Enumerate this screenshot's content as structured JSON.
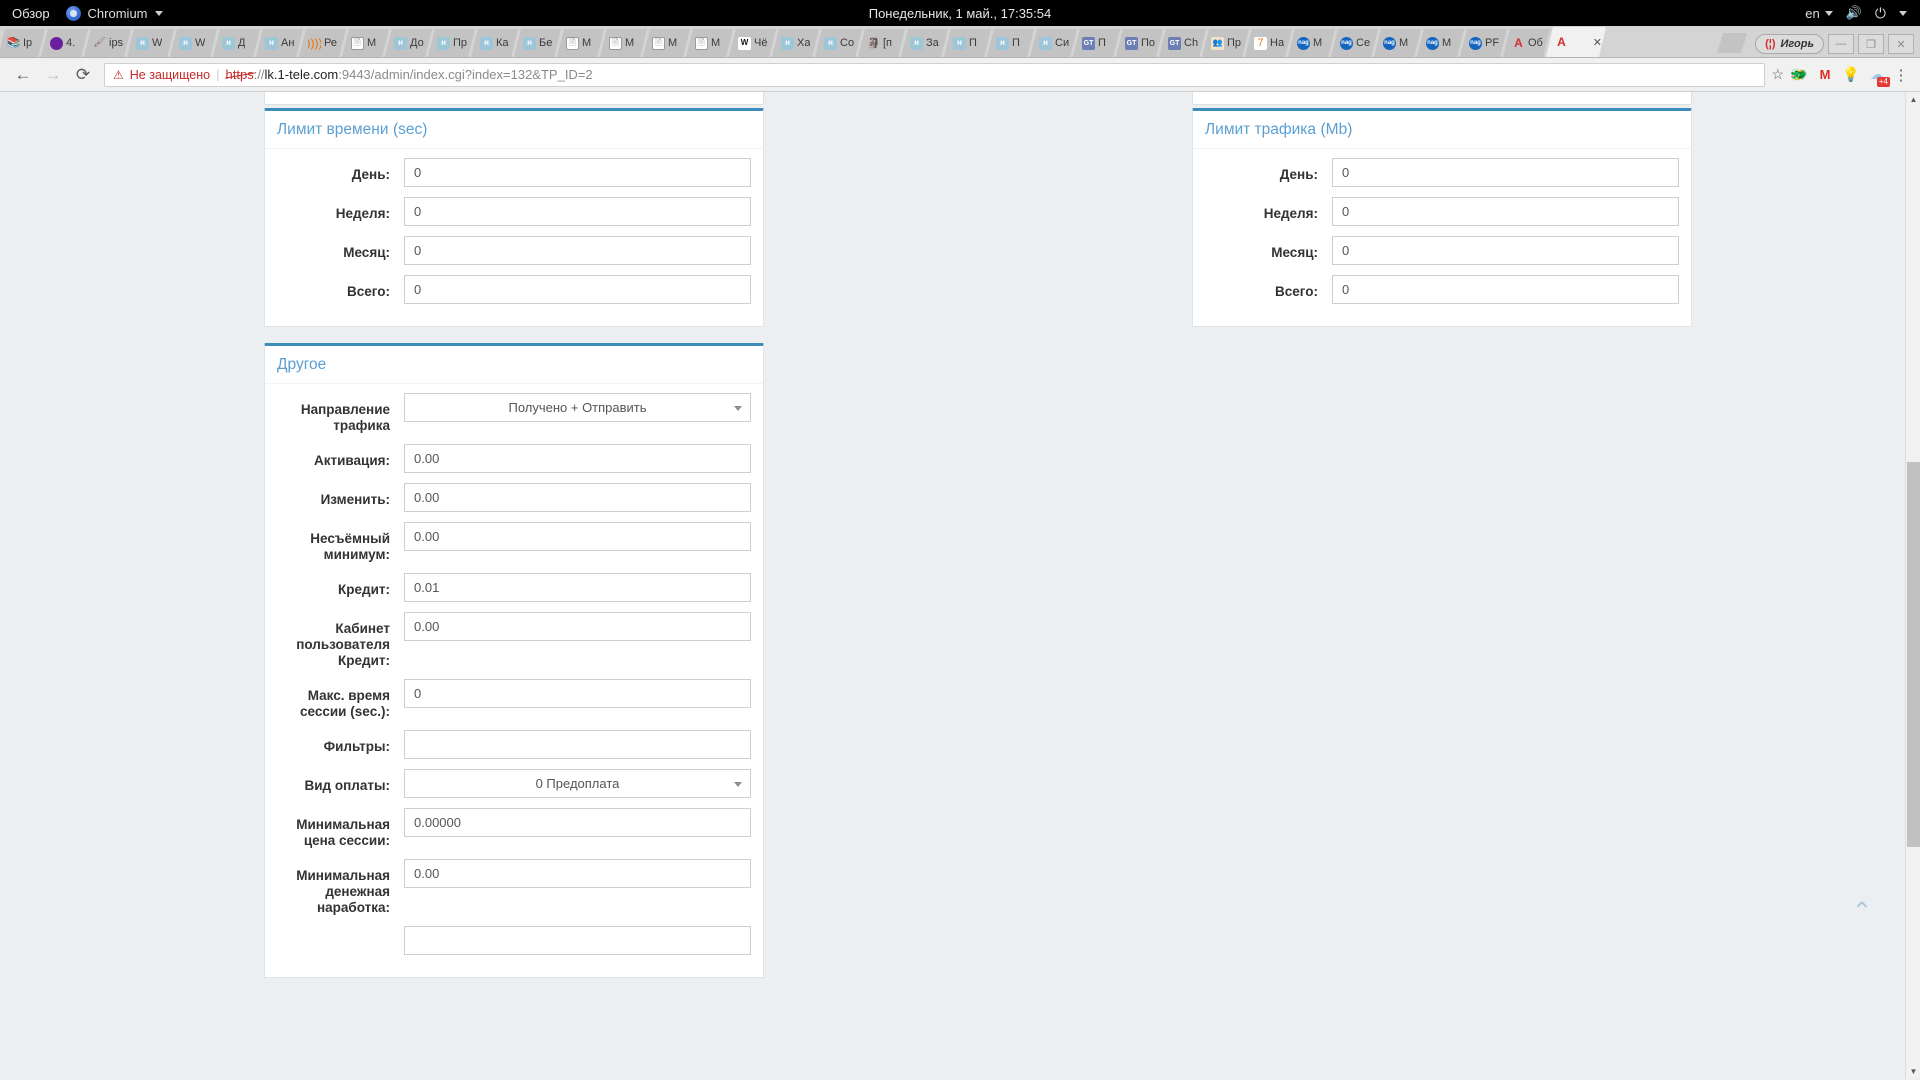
{
  "desktop": {
    "activities_label": "Обзор",
    "app_name": "Chromium",
    "clock": "Понедельник,  1 май., 17:35:54",
    "keyboard_layout": "en",
    "volume_icon": "volume-icon",
    "power_icon": "power-icon"
  },
  "browser": {
    "window_user": "Игорь",
    "window_user_icon": "user-icon",
    "minimize_label": "—",
    "maximize_label": "❐",
    "close_label": "✕",
    "active_tab_close": "✕",
    "tabs": [
      {
        "favicon": "books-icon",
        "title": "Ip",
        "fav_class": "fav-book",
        "glyph": "📚"
      },
      {
        "favicon": "purple-dot-icon",
        "title": "4.",
        "fav_class": "fav-dot",
        "glyph": ""
      },
      {
        "favicon": "paint-icon",
        "title": "ips",
        "fav_class": "fav-paint",
        "glyph": "🖌"
      },
      {
        "favicon": "hostel-icon",
        "title": "W",
        "fav_class": "fav-h",
        "glyph": "н"
      },
      {
        "favicon": "hostel-icon",
        "title": "W",
        "fav_class": "fav-h",
        "glyph": "н"
      },
      {
        "favicon": "hostel-icon",
        "title": "Д",
        "fav_class": "fav-h",
        "glyph": "н"
      },
      {
        "favicon": "hostel-icon",
        "title": "Ан",
        "fav_class": "fav-h",
        "glyph": "н"
      },
      {
        "favicon": "wifi-icon",
        "title": "Ре",
        "fav_class": "fav-orange",
        "glyph": "))))"
      },
      {
        "favicon": "document-icon",
        "title": "М",
        "fav_class": "fav-doc",
        "glyph": "🗎"
      },
      {
        "favicon": "hostel-icon",
        "title": "До",
        "fav_class": "fav-h",
        "glyph": "н"
      },
      {
        "favicon": "hostel-icon",
        "title": "Пр",
        "fav_class": "fav-h",
        "glyph": "н"
      },
      {
        "favicon": "hostel-icon",
        "title": "Ка",
        "fav_class": "fav-h",
        "glyph": "н"
      },
      {
        "favicon": "hostel-icon",
        "title": "Бе",
        "fav_class": "fav-h",
        "glyph": "н"
      },
      {
        "favicon": "document-icon",
        "title": "М",
        "fav_class": "fav-doc",
        "glyph": "🗎"
      },
      {
        "favicon": "document-icon",
        "title": "М",
        "fav_class": "fav-doc",
        "glyph": "🗎"
      },
      {
        "favicon": "document-icon",
        "title": "М",
        "fav_class": "fav-doc",
        "glyph": "🗎"
      },
      {
        "favicon": "document-icon",
        "title": "М",
        "fav_class": "fav-doc",
        "glyph": "🗎"
      },
      {
        "favicon": "wikipedia-icon",
        "title": "Чё",
        "fav_class": "fav-w",
        "glyph": "W"
      },
      {
        "favicon": "hostel-icon",
        "title": "Ха",
        "fav_class": "fav-h",
        "glyph": "н"
      },
      {
        "favicon": "hostel-icon",
        "title": "Со",
        "fav_class": "fav-h",
        "glyph": "н"
      },
      {
        "favicon": "gnome-icon",
        "title": "[п",
        "fav_class": "fav-red",
        "glyph": "🗿"
      },
      {
        "favicon": "hostel-icon",
        "title": "За",
        "fav_class": "fav-h",
        "glyph": "н"
      },
      {
        "favicon": "hostel-icon",
        "title": "П",
        "fav_class": "fav-h",
        "glyph": "н"
      },
      {
        "favicon": "hostel-icon",
        "title": "П",
        "fav_class": "fav-h",
        "glyph": "н"
      },
      {
        "favicon": "hostel-icon",
        "title": "Си",
        "fav_class": "fav-h",
        "glyph": "н"
      },
      {
        "favicon": "gt-icon",
        "title": "П",
        "fav_class": "fav-gt",
        "glyph": "GT"
      },
      {
        "favicon": "gt-icon",
        "title": "По",
        "fav_class": "fav-gt",
        "glyph": "GT"
      },
      {
        "favicon": "gt-icon",
        "title": "Ch",
        "fav_class": "fav-gt",
        "glyph": "GT"
      },
      {
        "favicon": "egypt-icon",
        "title": "Пр",
        "fav_class": "fav-egypt",
        "glyph": "👥"
      },
      {
        "favicon": "slash-icon",
        "title": "На",
        "fav_class": "fav-slash",
        "glyph": "7"
      },
      {
        "favicon": "nagios-icon",
        "title": "М",
        "fav_class": "fav-nag",
        "glyph": "nag"
      },
      {
        "favicon": "nagios-icon",
        "title": "Се",
        "fav_class": "fav-nag",
        "glyph": "nag"
      },
      {
        "favicon": "nagios-icon",
        "title": "М",
        "fav_class": "fav-nag",
        "glyph": "nag"
      },
      {
        "favicon": "nagios-icon",
        "title": "М",
        "fav_class": "fav-nag",
        "glyph": "nag"
      },
      {
        "favicon": "nagios-icon",
        "title": "PF",
        "fav_class": "fav-nag",
        "glyph": "nag"
      },
      {
        "favicon": "letter-a-icon",
        "title": "Об",
        "fav_class": "fav-a",
        "glyph": "A"
      }
    ],
    "active_tab": {
      "favicon": "letter-a-icon",
      "title": "",
      "fav_class": "fav-a",
      "glyph": "A"
    },
    "toolbar": {
      "back_icon": "back-arrow-icon",
      "forward_icon": "forward-arrow-icon",
      "reload_icon": "reload-icon",
      "bookmark_icon": "star-icon",
      "menu_icon": "kebab-menu-icon"
    },
    "omnibox": {
      "security_warning": "Не защищено",
      "warning_icon": "warning-triangle-icon",
      "url_scheme": "https",
      "url_separator": "://",
      "url_host": "lk.1-tele.com",
      "url_rest": ":9443/admin/index.cgi?index=132&TP_ID=2"
    },
    "extensions": [
      {
        "name": "extension-green-icon",
        "glyph": "🐲",
        "badge": ""
      },
      {
        "name": "gmail-icon",
        "glyph": "M",
        "badge": ""
      },
      {
        "name": "lightbulb-icon",
        "glyph": "💡",
        "badge": ""
      },
      {
        "name": "cloud-icon",
        "glyph": "☁",
        "badge": "+4"
      }
    ]
  },
  "page": {
    "scroll_top_icon": "chevron-up-icon",
    "scrollbar": {
      "up_icon": "scroll-up-arrow",
      "down_icon": "scroll-down-arrow"
    },
    "cards": {
      "time_limit": {
        "title": "Лимит времени",
        "unit": "(sec)",
        "fields": [
          {
            "label": "День:",
            "value": "0",
            "name": "day"
          },
          {
            "label": "Неделя:",
            "value": "0",
            "name": "week"
          },
          {
            "label": "Месяц:",
            "value": "0",
            "name": "month"
          },
          {
            "label": "Всего:",
            "value": "0",
            "name": "total"
          }
        ]
      },
      "traffic_limit": {
        "title": "Лимит трафика",
        "unit": "(Mb)",
        "fields": [
          {
            "label": "День:",
            "value": "0",
            "name": "day"
          },
          {
            "label": "Неделя:",
            "value": "0",
            "name": "week"
          },
          {
            "label": "Месяц:",
            "value": "0",
            "name": "month"
          },
          {
            "label": "Всего:",
            "value": "0",
            "name": "total"
          }
        ]
      },
      "other": {
        "title": "Другое",
        "unit": "",
        "fields": [
          {
            "label": "Направление трафика",
            "value": "Получено + Отправить",
            "type": "select",
            "name": "traffic-direction"
          },
          {
            "label": "Активация:",
            "value": "0.00",
            "type": "input",
            "name": "activation"
          },
          {
            "label": "Изменить:",
            "value": "0.00",
            "type": "input",
            "name": "change"
          },
          {
            "label": "Несъёмный минимум:",
            "value": "0.00",
            "type": "input",
            "name": "non-removable-minimum"
          },
          {
            "label": "Кредит:",
            "value": "0.01",
            "type": "input",
            "name": "credit"
          },
          {
            "label": "Кабинет пользователя Кредит:",
            "value": "0.00",
            "type": "input",
            "name": "user-cabinet-credit"
          },
          {
            "label": "Макс. время сессии (sec.):",
            "value": "0",
            "type": "input",
            "name": "max-session-time"
          },
          {
            "label": "Фильтры:",
            "value": "",
            "type": "input",
            "name": "filters"
          },
          {
            "label": "Вид оплаты:",
            "value": "0 Предоплата",
            "type": "select",
            "name": "payment-type"
          },
          {
            "label": "Минимальная цена сессии:",
            "value": "0.00000",
            "type": "input",
            "name": "min-session-price"
          },
          {
            "label": "Минимальная денежная наработка:",
            "value": "0.00",
            "type": "input",
            "name": "min-money-earning"
          },
          {
            "label": "",
            "value": "",
            "type": "input",
            "name": "next-partial"
          }
        ]
      }
    }
  }
}
